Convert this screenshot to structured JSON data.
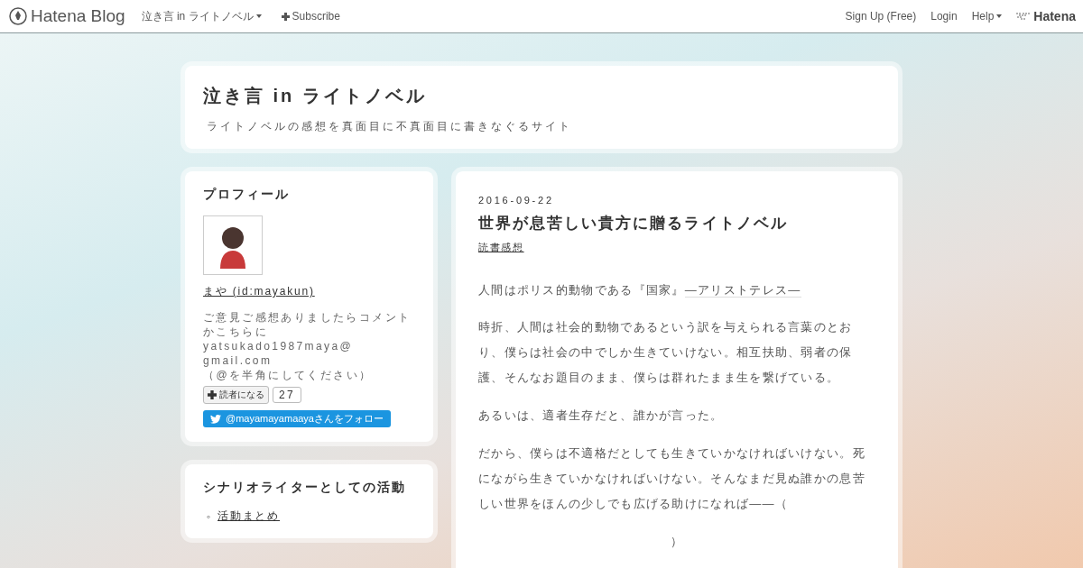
{
  "topbar": {
    "logo": "Hatena Blog",
    "blog_menu": "泣き言 in ライトノベル",
    "subscribe": "Subscribe",
    "links": [
      "Sign Up (Free)",
      "Login"
    ],
    "help": "Help",
    "brand": "Hatena"
  },
  "header": {
    "title": "泣き言 in ライトノベル",
    "description": "ライトノベルの感想を真面目に不真面目に書きなぐるサイト"
  },
  "profile": {
    "heading": "プロフィール",
    "name": "まや (id:mayakun)",
    "bio": [
      "ご意見ご感想ありましたらコメント",
      "かこちらに",
      "yatsukado1987maya@",
      "gmail.com",
      "（@を半角にしてください）"
    ],
    "follow_label": "読者になる",
    "follow_count": "27",
    "twitter": "@mayamayamaayaさんをフォロー"
  },
  "activity": {
    "heading": "シナリオライターとしての活動",
    "items": [
      {
        "marker": "◦",
        "label": "活動まとめ"
      }
    ]
  },
  "entry": {
    "date": "2016-09-22",
    "title": "世界が息苦しい貴方に贈るライトノベル",
    "category": "読書感想",
    "quote": "人間はポリス的動物である『国家』",
    "quote_link": "—アリストテレス—",
    "paragraphs": [
      "時折、人間は社会的動物であるという訳を与えられる言葉のとおり、僕らは社会の中でしか生きていけない。相互扶助、弱者の保護、そんなお題目のまま、僕らは群れたまま生を繋げている。",
      "あるいは、適者生存だと、誰かが言った。",
      "だから、僕らは不適格だとしても生きていかなければいけない。死にながら生きていかなければいけない。そんなまだ見ぬ誰かの息苦しい世界をほんの少しでも広げる助けになれば——（"
    ],
    "closing": "）"
  }
}
